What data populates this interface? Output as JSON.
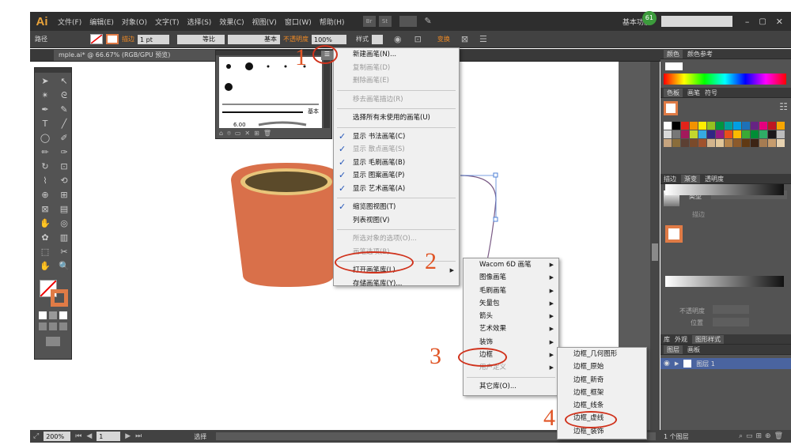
{
  "app": {
    "logo": "Ai",
    "menus": [
      "文件(F)",
      "编辑(E)",
      "对象(O)",
      "文字(T)",
      "选择(S)",
      "效果(C)",
      "视图(V)",
      "窗口(W)",
      "帮助(H)"
    ],
    "workspace": "基本功能",
    "notify_badge": "61",
    "br_label": "Br",
    "st_label": "St"
  },
  "control": {
    "object_type": "路径",
    "stroke_label": "描边",
    "stroke_size": "1 pt",
    "profile": "等比",
    "brush": "基本",
    "opacity_label": "不透明度",
    "opacity": "100%",
    "style_label": "样式",
    "transform": "变换"
  },
  "document_tab": "mple.ai* @ 66.67% (RGB/GPU 预览)",
  "brush_panel": {
    "stroke_text": "基本",
    "size_text": "6.00"
  },
  "flyout": {
    "items": [
      {
        "label": "新建画笔(N)...",
        "state": "enabled",
        "check": false,
        "sub": false
      },
      {
        "label": "复制画笔(D)",
        "state": "disabled",
        "check": false,
        "sub": false
      },
      {
        "label": "删除画笔(E)",
        "state": "disabled",
        "check": false,
        "sub": false
      },
      {
        "sep": true
      },
      {
        "label": "移去画笔描边(R)",
        "state": "disabled",
        "check": false,
        "sub": false
      },
      {
        "sep": true
      },
      {
        "label": "选择所有未使用的画笔(U)",
        "state": "enabled",
        "check": false,
        "sub": false
      },
      {
        "sep": true
      },
      {
        "label": "显示 书法画笔(C)",
        "state": "enabled",
        "check": true,
        "sub": false
      },
      {
        "label": "显示 散点画笔(S)",
        "state": "disabled",
        "check": true,
        "sub": false
      },
      {
        "label": "显示 毛刷画笔(B)",
        "state": "enabled",
        "check": true,
        "sub": false
      },
      {
        "label": "显示 图案画笔(P)",
        "state": "enabled",
        "check": true,
        "sub": false
      },
      {
        "label": "显示 艺术画笔(A)",
        "state": "enabled",
        "check": true,
        "sub": false
      },
      {
        "sep": true
      },
      {
        "label": "缩览图视图(T)",
        "state": "enabled",
        "check": true,
        "sub": false
      },
      {
        "label": "列表视图(V)",
        "state": "enabled",
        "check": false,
        "sub": false
      },
      {
        "sep": true
      },
      {
        "label": "所选对象的选项(O)...",
        "state": "disabled",
        "check": false,
        "sub": false
      },
      {
        "label": "画笔选项(B)...",
        "state": "disabled",
        "check": false,
        "sub": false
      },
      {
        "sep": true
      },
      {
        "label": "打开画笔库(L)",
        "state": "enabled",
        "check": false,
        "sub": true
      },
      {
        "label": "存储画笔库(Y)...",
        "state": "enabled",
        "check": false,
        "sub": false
      }
    ]
  },
  "library_submenu": {
    "items": [
      {
        "label": "Wacom 6D 画笔",
        "state": "enabled",
        "sub": true
      },
      {
        "label": "图像画笔",
        "state": "enabled",
        "sub": true
      },
      {
        "label": "毛刷画笔",
        "state": "enabled",
        "sub": true
      },
      {
        "label": "矢量包",
        "state": "enabled",
        "sub": true
      },
      {
        "label": "箭头",
        "state": "enabled",
        "sub": true
      },
      {
        "label": "艺术效果",
        "state": "enabled",
        "sub": true
      },
      {
        "label": "装饰",
        "state": "enabled",
        "sub": true
      },
      {
        "label": "边框",
        "state": "enabled",
        "sub": true
      },
      {
        "label": "用户定义",
        "state": "disabled",
        "sub": true
      },
      {
        "sep": true
      },
      {
        "label": "其它库(O)...",
        "state": "enabled",
        "sub": false
      }
    ]
  },
  "border_submenu": {
    "items": [
      "边框_几何图形",
      "边框_原始",
      "边框_新奇",
      "边框_框架",
      "边框_线条",
      "边框_虚线",
      "边框_装饰"
    ]
  },
  "annotations": [
    "1",
    "2",
    "3",
    "4"
  ],
  "status": {
    "zoom": "200%",
    "page": "1",
    "mode": "选择"
  },
  "right_panel": {
    "color_tabs": [
      "颜色",
      "颜色参考"
    ],
    "swatch_tabs": [
      "色板",
      "画笔",
      "符号"
    ],
    "stroke_tabs": [
      "描边",
      "渐变",
      "透明度"
    ],
    "gradient": {
      "type_label": "类型",
      "stroke_label": "描边",
      "opacity_label": "不透明度",
      "position_label": "位置"
    },
    "lower_tabs": [
      "库",
      "外观",
      "图形样式"
    ],
    "layer_tabs": [
      "图层",
      "画板"
    ],
    "layer_name": "图层 1",
    "layer_count": "1 个图层",
    "colors": {
      "swatch_row1": [
        "#ffffff",
        "#000000",
        "#e2231a",
        "#f39200",
        "#ffed00",
        "#95c11f",
        "#009640",
        "#00a19a",
        "#009fe3",
        "#1d71b8",
        "#662483",
        "#e6007e",
        "#be1622",
        "#f7a600"
      ],
      "swatch_row2": [
        "#d9d9d9",
        "#777777",
        "#a3195b",
        "#c2d62e",
        "#36a9e1",
        "#312783",
        "#951b81",
        "#e94e1b",
        "#fbba00",
        "#3aaa35",
        "#008d36",
        "#2fac66",
        "#1a171b",
        "#bcbcbc"
      ],
      "swatch_row3": [
        "#c6a47f",
        "#8a6d3b",
        "#5c4033",
        "#7a4a2a",
        "#a0522d",
        "#d2b48c",
        "#e1c699",
        "#b5834a",
        "#8c5a2b",
        "#603913",
        "#3c2415",
        "#a67c52",
        "#c69c6d",
        "#e7d2b0"
      ]
    },
    "spectrum": [
      "#ff0000",
      "#ffff00",
      "#00ff00",
      "#00ffff",
      "#0000ff",
      "#ff00ff",
      "#ff0000"
    ]
  },
  "cup": {
    "body": "#d9704a",
    "rim": "#e8c57a",
    "inner": "#5b4a2a"
  }
}
